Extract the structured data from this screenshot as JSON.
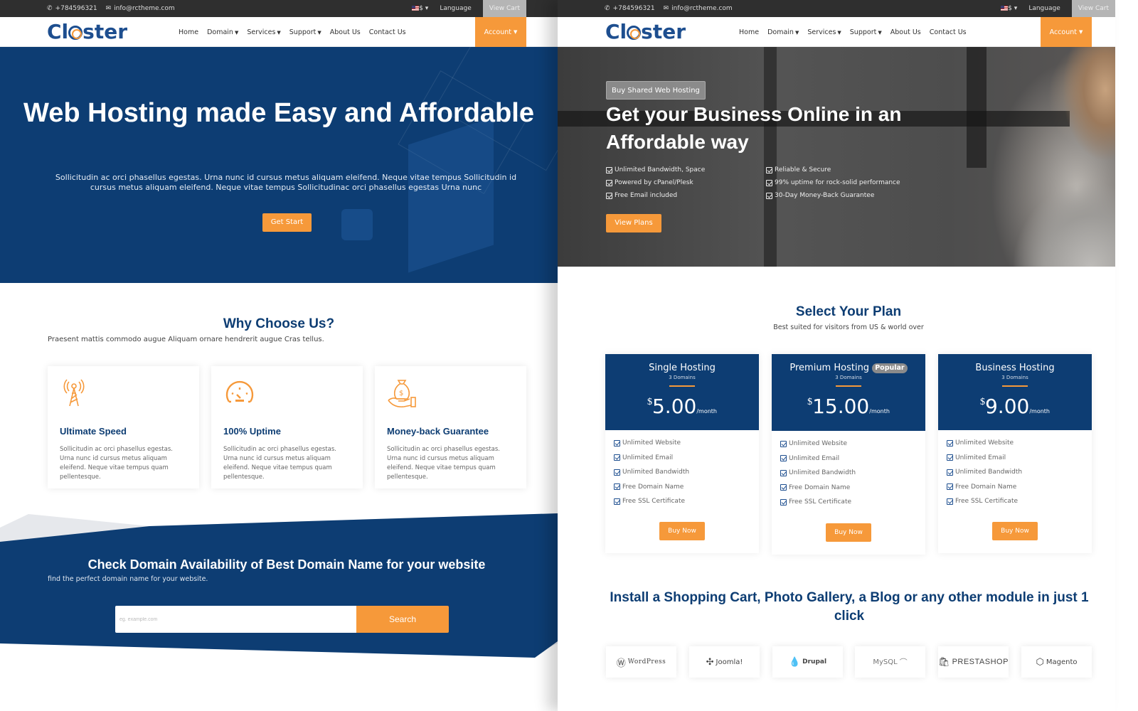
{
  "topbar": {
    "phone": "+784596321",
    "email": "info@rctheme.com",
    "currency": "$",
    "language": "Language",
    "view_cart": "View Cart"
  },
  "nav": {
    "logo": "Closter",
    "items": [
      {
        "label": "Home",
        "dropdown": false
      },
      {
        "label": "Domain",
        "dropdown": true
      },
      {
        "label": "Services",
        "dropdown": true
      },
      {
        "label": "Support",
        "dropdown": true
      },
      {
        "label": "About Us",
        "dropdown": false
      },
      {
        "label": "Contact Us",
        "dropdown": false
      }
    ],
    "account": "Account"
  },
  "left": {
    "hero": {
      "title": "Web Hosting made Easy and Affordable",
      "text": "Sollicitudin ac orci phasellus egestas. Urna nunc id cursus metus aliquam eleifend. Neque vitae tempus Sollicitudin id cursus metus aliquam eleifend. Neque vitae tempus Sollicitudinac orci phasellus egestas Urna nunc",
      "button": "Get Start"
    },
    "why": {
      "title": "Why Choose Us?",
      "subtitle": "Praesent mattis commodo augue Aliquam ornare hendrerit augue Cras tellus.",
      "features": [
        {
          "icon": "antenna-tower-icon",
          "title": "Ultimate Speed",
          "text": "Sollicitudin ac orci phasellus egestas. Urna nunc id cursus metus aliquam eleifend. Neque vitae tempus quam pellentesque."
        },
        {
          "icon": "speedometer-icon",
          "title": "100% Uptime",
          "text": "Sollicitudin ac orci phasellus egestas. Urna nunc id cursus metus aliquam eleifend. Neque vitae tempus quam pellentesque."
        },
        {
          "icon": "money-bag-hand-icon",
          "title": "Money-back Guarantee",
          "text": "Sollicitudin ac orci phasellus egestas. Urna nunc id cursus metus aliquam eleifend. Neque vitae tempus quam pellentesque."
        }
      ]
    },
    "domain": {
      "title": "Check Domain Availability of Best Domain Name for your website",
      "subtitle": "find the perfect domain name for your website.",
      "placeholder": "eg. example.com",
      "value": "",
      "button": "Search"
    }
  },
  "right": {
    "hero": {
      "tag": "Buy Shared Web Hosting",
      "title": "Get your Business Online in an Affordable way",
      "features": [
        "Unlimited Bandwidth, Space",
        "Reliable & Secure",
        "Powered by cPanel/Plesk",
        "99% uptime for rock-solid performance",
        "Free Email included",
        "30-Day Money-Back Guarantee"
      ],
      "button": "View Plans"
    },
    "plans": {
      "title": "Select Your Plan",
      "subtitle": "Best suited for visitors from US & world over",
      "items": [
        {
          "name": "Single Hosting",
          "badge": "",
          "domains": "3 Domains",
          "currency": "$",
          "price": "5.00",
          "period": "/month",
          "features": [
            "Unlimited Website",
            "Unlimited Email",
            "Unlimited Bandwidth",
            "Free Domain Name",
            "Free SSL Certificate"
          ],
          "button": "Buy Now"
        },
        {
          "name": "Premium Hosting",
          "badge": "Popular",
          "domains": "3 Domains",
          "currency": "$",
          "price": "15.00",
          "period": "/month",
          "features": [
            "Unlimited Website",
            "Unlimited Email",
            "Unlimited Bandwidth",
            "Free Domain Name",
            "Free SSL Certificate"
          ],
          "button": "Buy Now"
        },
        {
          "name": "Business Hosting",
          "badge": "",
          "domains": "3 Domains",
          "currency": "$",
          "price": "9.00",
          "period": "/month",
          "features": [
            "Unlimited Website",
            "Unlimited Email",
            "Unlimited Bandwidth",
            "Free Domain Name",
            "Free SSL Certificate"
          ],
          "button": "Buy Now"
        }
      ]
    },
    "install": {
      "title": "Install a Shopping Cart, Photo Gallery, a Blog or any other module in just 1 click",
      "logos": [
        "WordPress",
        "Joomla!",
        "Drupal",
        "MySQL",
        "PRESTASHOP",
        "Magento"
      ]
    }
  },
  "colors": {
    "primary": "#0d3d73",
    "accent": "#f6993a",
    "topbar": "#2f2f2f"
  }
}
